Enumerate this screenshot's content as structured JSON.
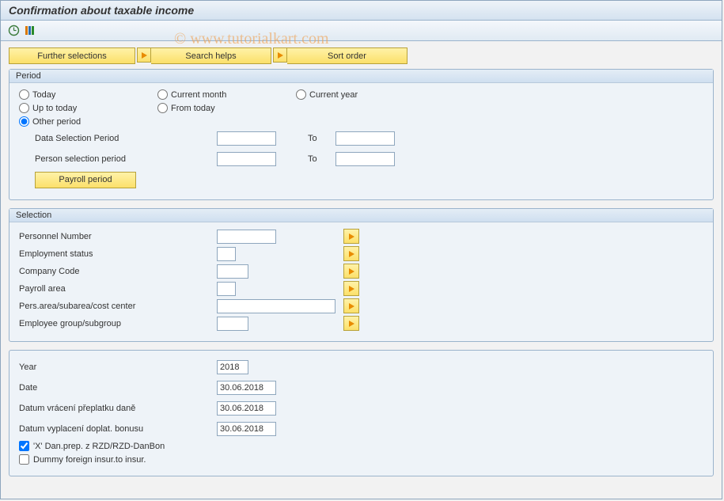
{
  "title": "Confirmation about taxable income",
  "watermark": "© www.tutorialkart.com",
  "topButtons": {
    "further": "Further selections",
    "search": "Search helps",
    "sort": "Sort order"
  },
  "period": {
    "legend": "Period",
    "today": "Today",
    "currentMonth": "Current month",
    "currentYear": "Current year",
    "upToToday": "Up to today",
    "fromToday": "From today",
    "otherPeriod": "Other period",
    "dataSelPeriod": "Data Selection Period",
    "personSelPeriod": "Person selection period",
    "to": "To",
    "payrollPeriod": "Payroll period",
    "selected": "otherPeriod",
    "values": {
      "dataFrom": "",
      "dataTo": "",
      "personFrom": "",
      "personTo": ""
    }
  },
  "selection": {
    "legend": "Selection",
    "rows": [
      {
        "label": "Personnel Number",
        "value": "",
        "width": "inp-sm"
      },
      {
        "label": "Employment status",
        "value": "",
        "width": "inp-xs"
      },
      {
        "label": "Company Code",
        "value": "",
        "width": "inp-md"
      },
      {
        "label": "Payroll area",
        "value": "",
        "width": "inp-xs"
      },
      {
        "label": "Pers.area/subarea/cost center",
        "value": "",
        "width": "inp-w"
      },
      {
        "label": "Employee group/subgroup",
        "value": "",
        "width": "inp-md"
      }
    ]
  },
  "params": {
    "year": {
      "label": "Year",
      "value": "2018"
    },
    "date": {
      "label": "Date",
      "value": "30.06.2018"
    },
    "datumVraceni": {
      "label": "Datum vrácení přeplatku daně",
      "value": "30.06.2018"
    },
    "datumVyplaceni": {
      "label": "Datum vyplacení doplat. bonusu",
      "value": "30.06.2018"
    },
    "danPrep": {
      "label": "'X' Dan.prep. z RZD/RZD-DanBon",
      "checked": true
    },
    "dummy": {
      "label": "Dummy foreign insur.to insur.",
      "checked": false
    }
  }
}
